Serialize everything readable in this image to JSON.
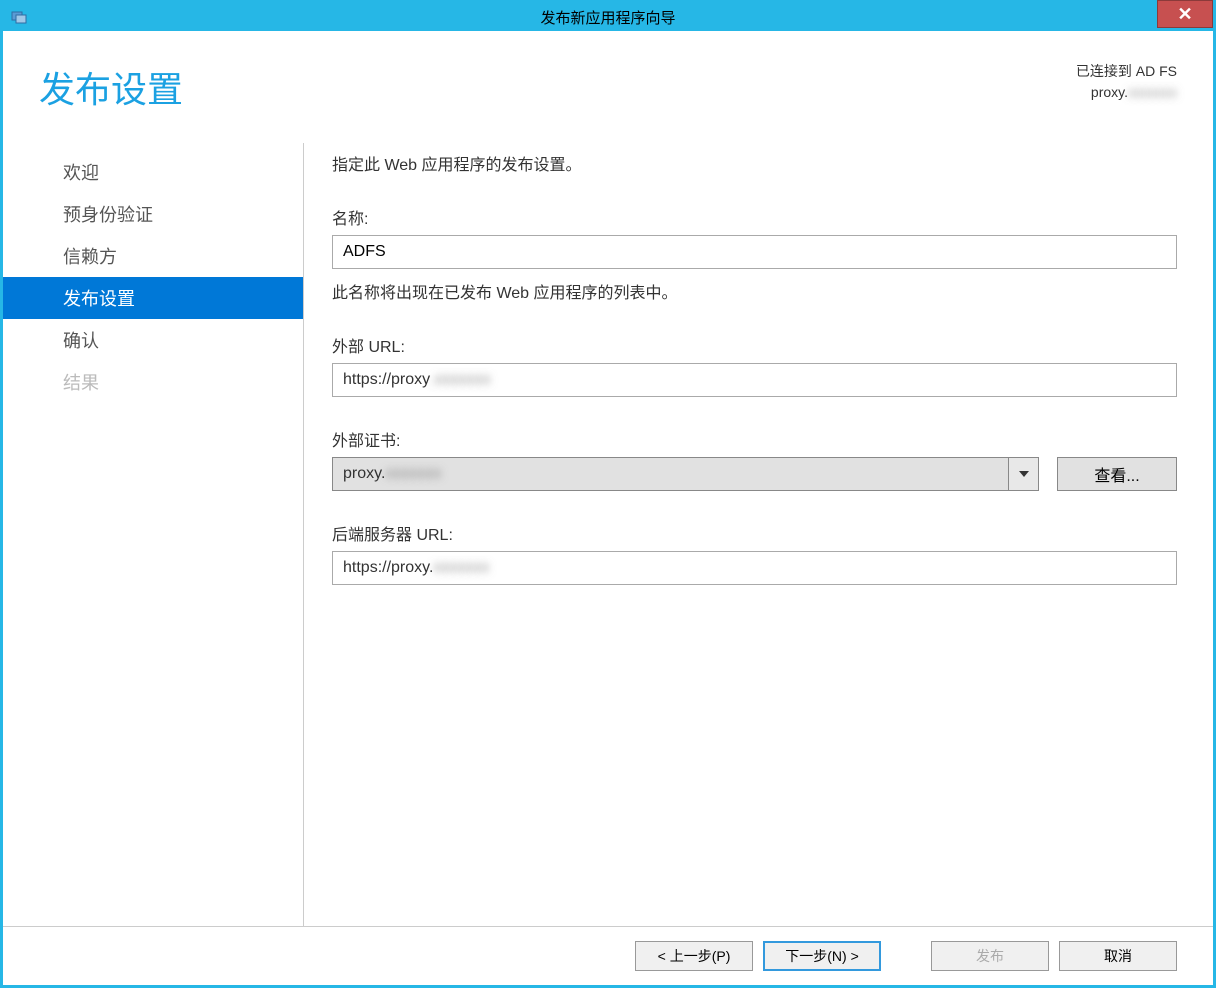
{
  "window": {
    "title": "发布新应用程序向导",
    "close": "✕"
  },
  "header": {
    "heading": "发布设置",
    "status_line1": "已连接到 AD FS",
    "status_line2_prefix": "proxy.",
    "status_line2_redacted": "xxxxxxx"
  },
  "sidebar": {
    "items": [
      {
        "label": "欢迎",
        "state": "normal"
      },
      {
        "label": "预身份验证",
        "state": "normal"
      },
      {
        "label": "信赖方",
        "state": "normal"
      },
      {
        "label": "发布设置",
        "state": "active"
      },
      {
        "label": "确认",
        "state": "normal"
      },
      {
        "label": "结果",
        "state": "disabled"
      }
    ]
  },
  "content": {
    "instruction": "指定此 Web 应用程序的发布设置。",
    "name_label": "名称:",
    "name_value": "ADFS",
    "name_help": "此名称将出现在已发布 Web 应用程序的列表中。",
    "ext_url_label": "外部 URL:",
    "ext_url_prefix": "https://proxy",
    "ext_url_redacted": ".xxxxxxx",
    "ext_cert_label": "外部证书:",
    "ext_cert_prefix": "proxy.",
    "ext_cert_redacted": "xxxxxxx",
    "view_btn": "查看...",
    "backend_url_label": "后端服务器 URL:",
    "backend_url_prefix": "https://proxy.",
    "backend_url_redacted": "xxxxxxx"
  },
  "footer": {
    "prev": "< 上一步(P)",
    "next": "下一步(N) >",
    "publish": "发布",
    "cancel": "取消"
  }
}
